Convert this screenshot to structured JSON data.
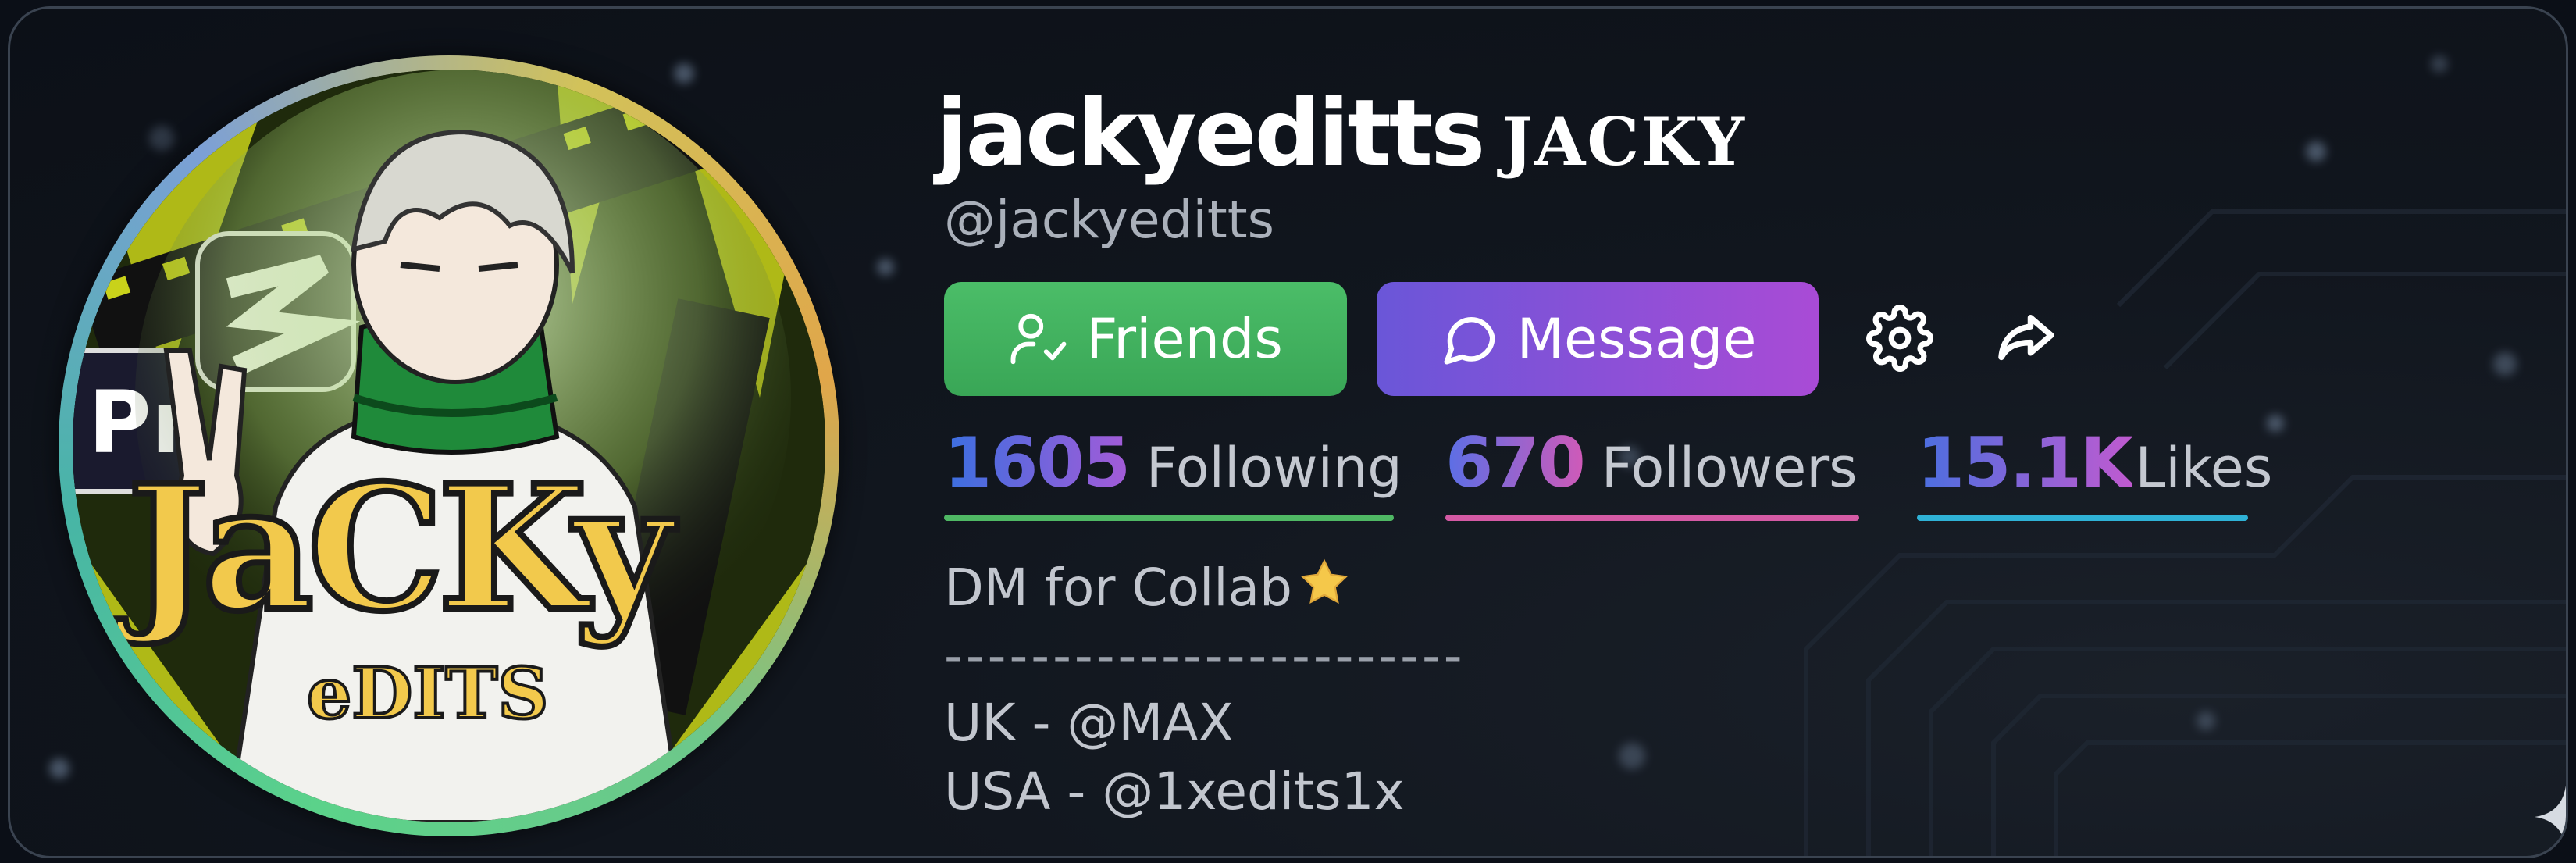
{
  "profile": {
    "display_name": "jackyeditts",
    "display_name_stylized": "JACKY",
    "handle": "@jackyeditts",
    "avatar_text": {
      "main": "JaCKy",
      "sub": "eDITS"
    }
  },
  "actions": {
    "friends_label": "Friends",
    "message_label": "Message",
    "friends_icon": "user-check-icon",
    "message_icon": "chat-bubble-icon",
    "settings_icon": "gear-icon",
    "share_icon": "share-icon"
  },
  "stats": [
    {
      "value": "1605",
      "label": "Following"
    },
    {
      "value": "670",
      "label": "Followers"
    },
    {
      "value": "15.1K",
      "label": "Likes"
    }
  ],
  "bio": {
    "line1": "DM for Collab",
    "line1_emoji": "star",
    "divider": "------------------------",
    "line3": "UK - @MAX",
    "line4": "USA - @1xedits1x"
  },
  "colors": {
    "friends_button": "#43b463",
    "message_button_start": "#6a56d8",
    "message_button_end": "#a94bd6",
    "following_underline": "#4fb864",
    "followers_underline": "#d45aa4",
    "likes_underline": "#2fb2d6"
  }
}
